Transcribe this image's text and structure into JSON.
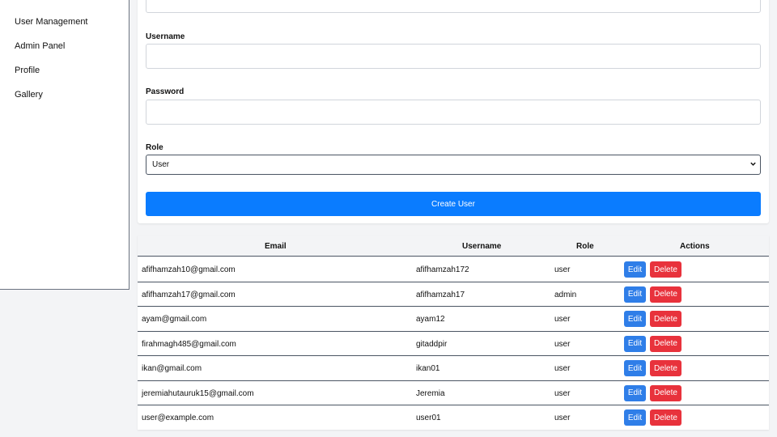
{
  "sidebar": {
    "items": [
      {
        "label": "User Management"
      },
      {
        "label": "Admin Panel"
      },
      {
        "label": "Profile"
      },
      {
        "label": "Gallery"
      }
    ]
  },
  "form": {
    "username_label": "Username",
    "username_value": "",
    "password_label": "Password",
    "password_value": "",
    "role_label": "Role",
    "role_selected": "User",
    "create_button": "Create User"
  },
  "table": {
    "headers": [
      "Email",
      "Username",
      "Role",
      "Actions"
    ],
    "edit_label": "Edit",
    "delete_label": "Delete",
    "rows": [
      {
        "email": "afifhamzah10@gmail.com",
        "username": "afifhamzah172",
        "role": "user"
      },
      {
        "email": "afifhamzah17@gmail.com",
        "username": "afifhamzah17",
        "role": "admin"
      },
      {
        "email": "ayam@gmail.com",
        "username": "ayam12",
        "role": "user"
      },
      {
        "email": "firahmagh485@gmail.com",
        "username": "gitaddpir",
        "role": "user"
      },
      {
        "email": "ikan@gmail.com",
        "username": "ikan01",
        "role": "user"
      },
      {
        "email": "jeremiahutauruk15@gmail.com",
        "username": "Jeremia",
        "role": "user"
      },
      {
        "email": "user@example.com",
        "username": "user01",
        "role": "user"
      }
    ]
  },
  "colors": {
    "primary": "#0a7cff",
    "edit": "#2f7ee8",
    "delete": "#e8323c"
  }
}
